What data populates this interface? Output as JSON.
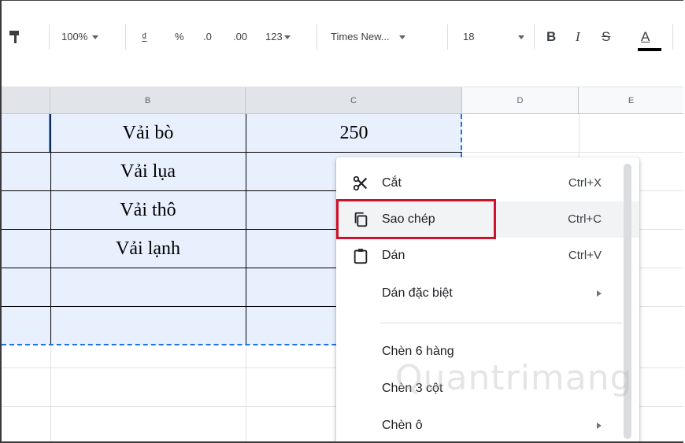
{
  "toolbar": {
    "zoom": "100%",
    "currency": "₫",
    "percent": "%",
    "decrease_decimal": ".0",
    "increase_decimal": ".00",
    "number_format": "123",
    "font": "Times New...",
    "font_size": "18",
    "bold": "B",
    "italic": "I",
    "strikethrough": "S",
    "text_color": "A"
  },
  "columns": [
    "B",
    "C",
    "D",
    "E"
  ],
  "rows": [
    {
      "b": "Vải bò",
      "c": "250"
    },
    {
      "b": "Vải lụa",
      "c": ""
    },
    {
      "b": "Vải thô",
      "c": ""
    },
    {
      "b": "Vải lạnh",
      "c": ""
    },
    {
      "b": "",
      "c": ""
    },
    {
      "b": "",
      "c": ""
    }
  ],
  "menu": {
    "items": [
      {
        "label": "Cắt",
        "shortcut": "Ctrl+X",
        "icon": "scissors-icon"
      },
      {
        "label": "Sao chép",
        "shortcut": "Ctrl+C",
        "icon": "copy-icon"
      },
      {
        "label": "Dán",
        "shortcut": "Ctrl+V",
        "icon": "clipboard-icon"
      },
      {
        "label": "Dán đặc biệt",
        "shortcut": "",
        "icon": ""
      },
      {
        "label": "Chèn 6 hàng",
        "shortcut": "",
        "icon": ""
      },
      {
        "label": "Chèn 3 cột",
        "shortcut": "",
        "icon": ""
      },
      {
        "label": "Chèn ô",
        "shortcut": "",
        "icon": ""
      }
    ]
  },
  "watermark": "Quantrimang",
  "colors": {
    "selection": "#e8f0fe",
    "accent": "#1a73e8",
    "highlight_box": "#d0112b"
  }
}
